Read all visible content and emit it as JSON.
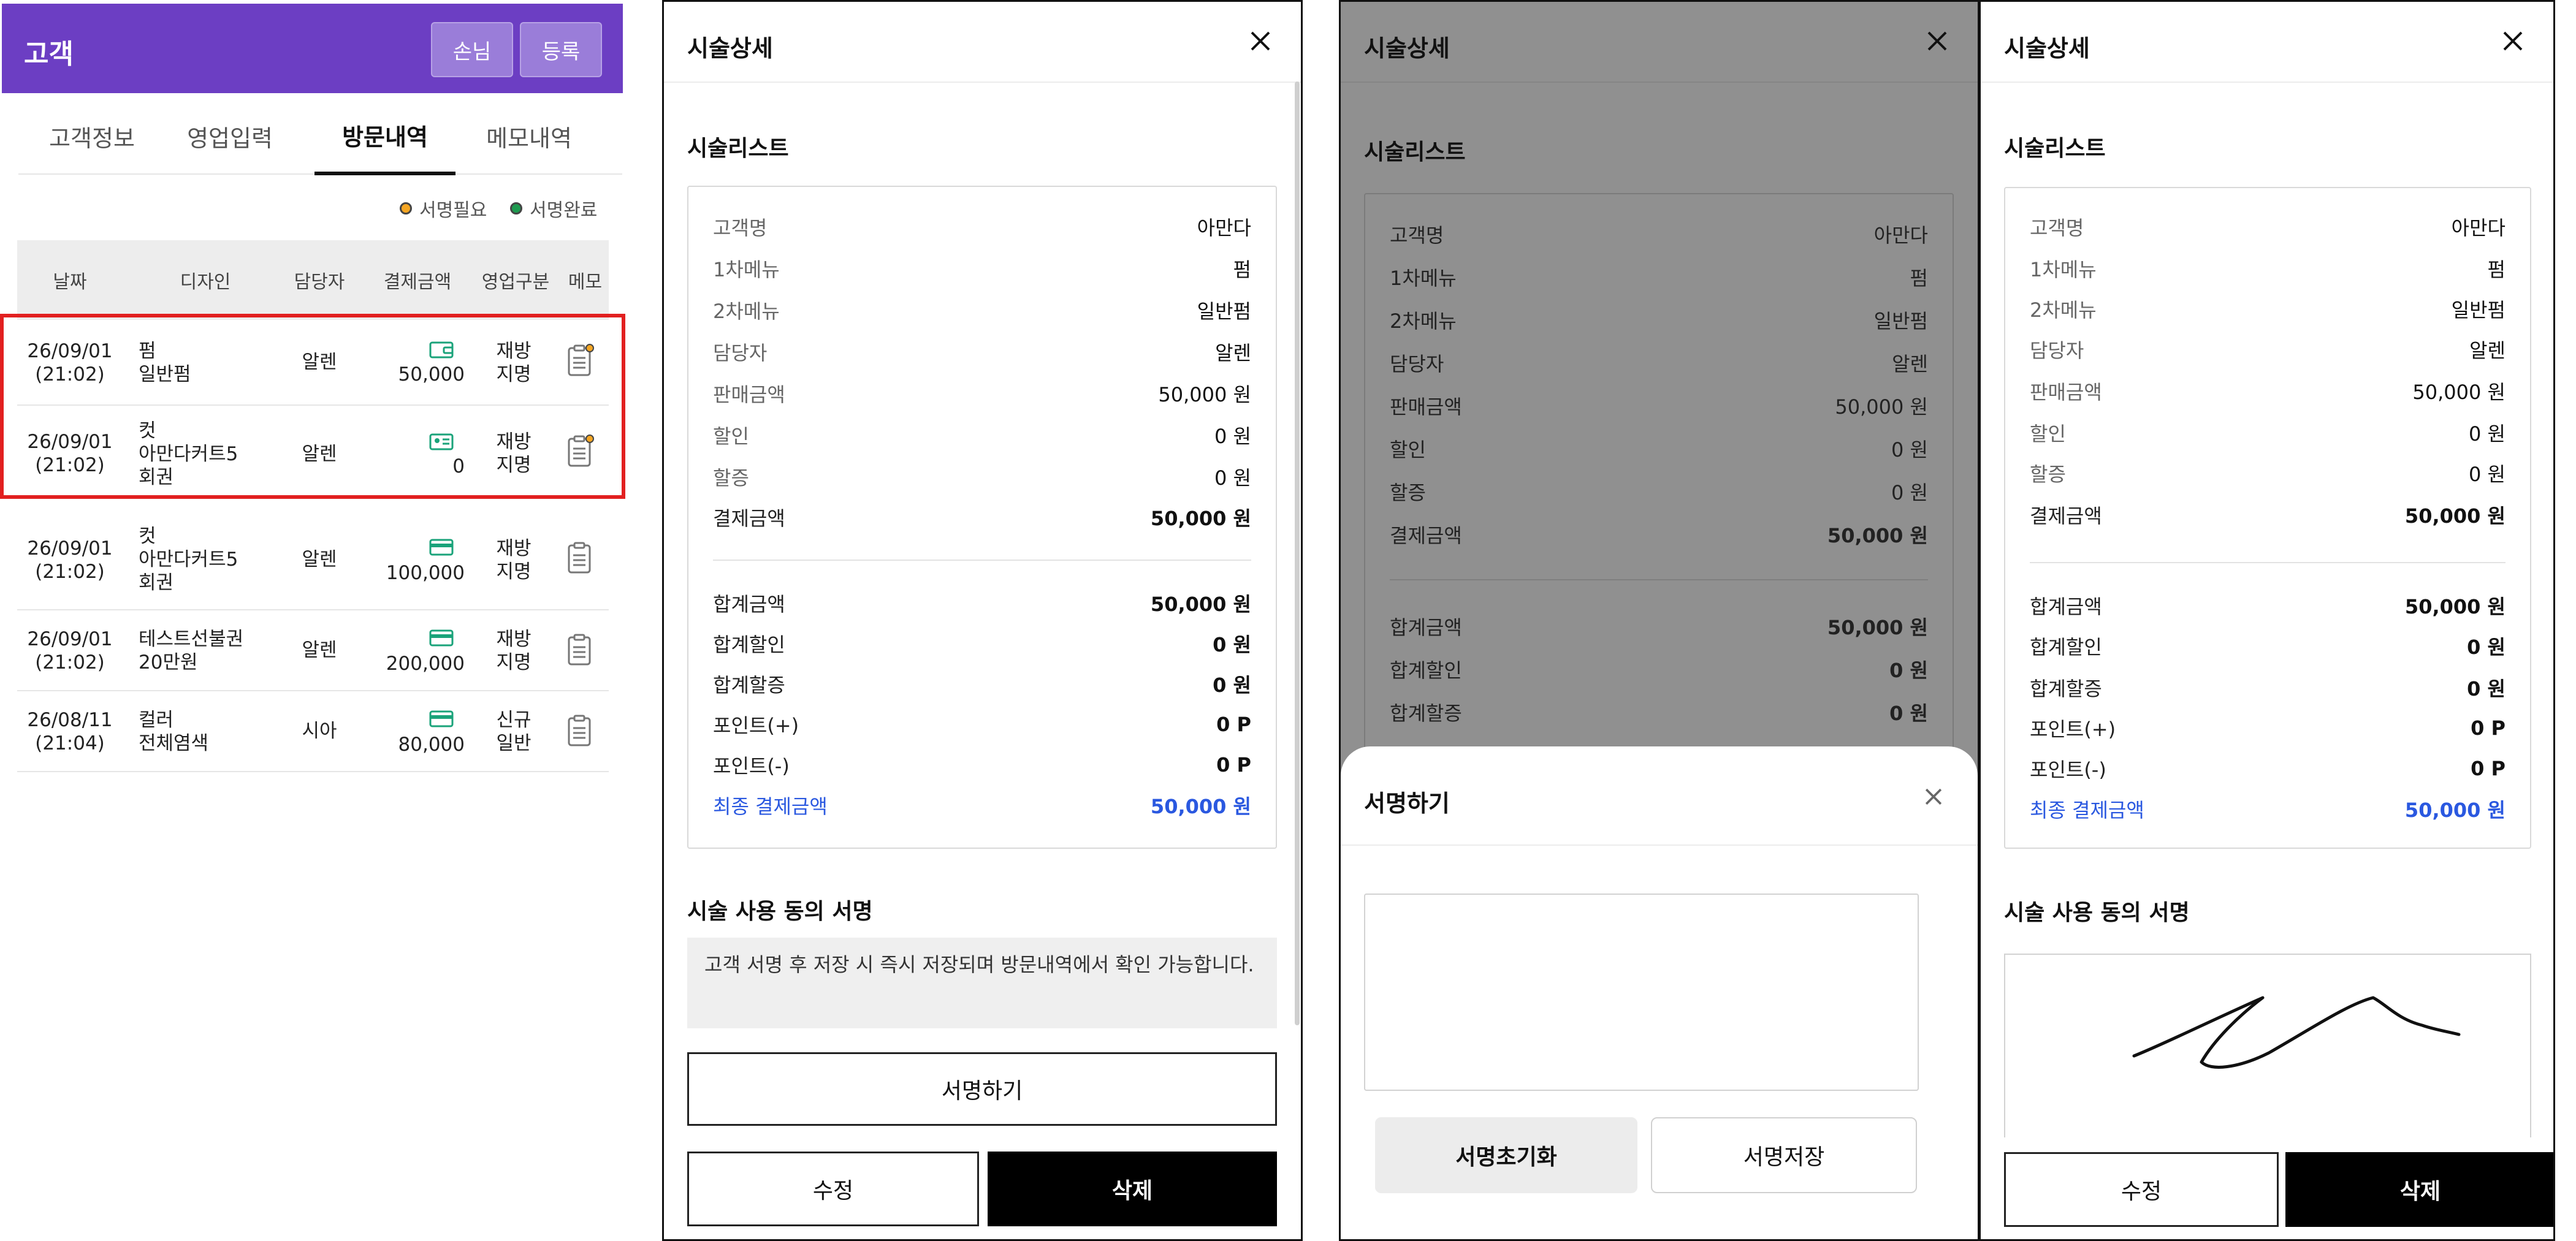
{
  "customer": {
    "title": "고객",
    "buttons": {
      "guest": "손님",
      "register": "등록"
    },
    "tabs": [
      "고객정보",
      "영업입력",
      "방문내역",
      "메모내역"
    ],
    "active_tab": "방문내역",
    "legend": {
      "need_sign": "서명필요",
      "signed": "서명완료"
    },
    "table_headers": [
      "날짜",
      "디자인",
      "담당자",
      "결제금액",
      "영업구분",
      "메모"
    ],
    "rows": [
      {
        "date": "26/09/01",
        "time": "(21:02)",
        "design": [
          "펌",
          "일반펌"
        ],
        "staff": "알렌",
        "amount": "50,000",
        "pay_icon": "wallet-icon",
        "type": [
          "재방",
          "지명"
        ],
        "memo_state": "need-sign"
      },
      {
        "date": "26/09/01",
        "time": "(21:02)",
        "design": [
          "컷",
          "아만다커트5",
          "회권"
        ],
        "staff": "알렌",
        "amount": "0",
        "pay_icon": "membership-card-icon",
        "type": [
          "재방",
          "지명"
        ],
        "memo_state": "need-sign"
      },
      {
        "date": "26/09/01",
        "time": "(21:02)",
        "design": [
          "컷",
          "아만다커트5",
          "회권"
        ],
        "staff": "알렌",
        "amount": "100,000",
        "pay_icon": "credit-card-icon",
        "type": [
          "재방",
          "지명"
        ],
        "memo_state": "none"
      },
      {
        "date": "26/09/01",
        "time": "(21:02)",
        "design": [
          "테스트선불권",
          "20만원"
        ],
        "staff": "알렌",
        "amount": "200,000",
        "pay_icon": "credit-card-icon",
        "type": [
          "재방",
          "지명"
        ],
        "memo_state": "none"
      },
      {
        "date": "26/08/11",
        "time": "(21:04)",
        "design": [
          "컬러",
          "전체염색"
        ],
        "staff": "시아",
        "amount": "80,000",
        "pay_icon": "credit-card-icon",
        "type": [
          "신규",
          "일반"
        ],
        "memo_state": "none"
      }
    ]
  },
  "detail": {
    "title": "시술상세",
    "list_title": "시술리스트",
    "items": [
      {
        "label": "고객명",
        "value": "아만다"
      },
      {
        "label": "1차메뉴",
        "value": "펌"
      },
      {
        "label": "2차메뉴",
        "value": "일반펌"
      },
      {
        "label": "담당자",
        "value": "알렌"
      },
      {
        "label": "판매금액",
        "value": "50,000 원"
      },
      {
        "label": "할인",
        "value": "0 원"
      },
      {
        "label": "할증",
        "value": "0 원"
      },
      {
        "label": "결제금액",
        "value": "50,000 원"
      }
    ],
    "totals": [
      {
        "label": "합계금액",
        "value": "50,000 원"
      },
      {
        "label": "합계할인",
        "value": "0 원"
      },
      {
        "label": "합계할증",
        "value": "0 원"
      },
      {
        "label": "포인트(+)",
        "value": "0 P"
      },
      {
        "label": "포인트(-)",
        "value": "0 P"
      }
    ],
    "final": {
      "label": "최종 결제금액",
      "value": "50,000 원"
    },
    "consent_title": "시술 사용 동의 서명",
    "consent_notice": "고객 서명 후 저장 시 즉시 저장되며 방문내역에서 확인 가능합니다.",
    "sign_button": "서명하기",
    "edit_button": "수정",
    "delete_button": "삭제"
  },
  "sign_sheet": {
    "title": "서명하기",
    "reset_button": "서명초기화",
    "save_button": "서명저장"
  },
  "colors": {
    "brand": "#6c3ec3",
    "need_sign": "#f5a623",
    "signed": "#1e9a4f",
    "final_amount": "#2a58e0",
    "pay_icon": "#1aa37a"
  }
}
